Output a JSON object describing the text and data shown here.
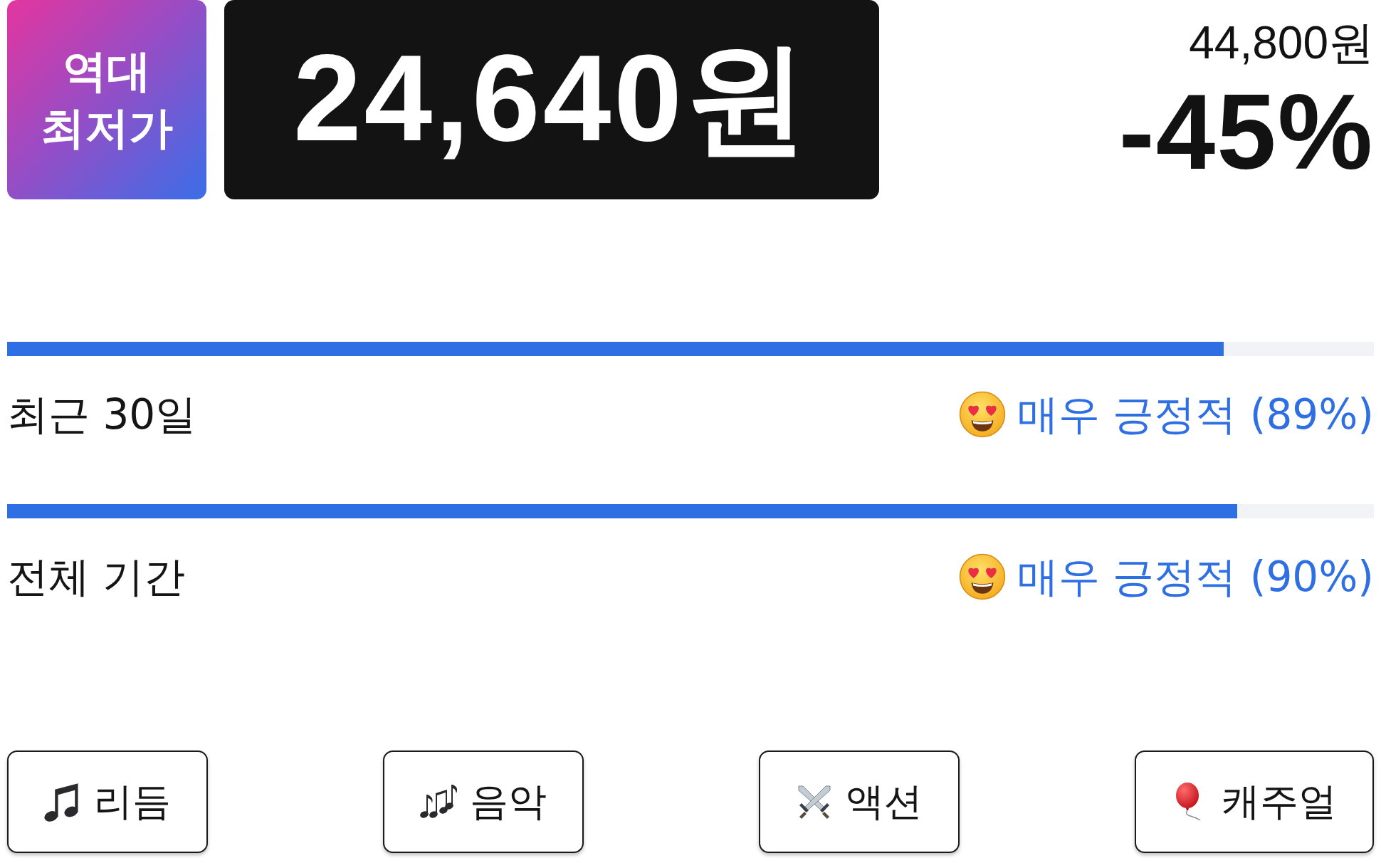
{
  "price": {
    "badge": "역대 최저가",
    "sale_price": "24,640원",
    "original_price": "44,800원",
    "discount": "-45%"
  },
  "reviews": [
    {
      "period": "최근 30일",
      "level": 0.89,
      "summary": "매우 긍정적 (89%)"
    },
    {
      "period": "전체 기간",
      "level": 0.9,
      "summary": "매우 긍정적 (90%)"
    }
  ],
  "tags": [
    {
      "kind": "rhythm",
      "label": "리듬"
    },
    {
      "kind": "music",
      "label": "음악"
    },
    {
      "kind": "action",
      "label": "액션"
    },
    {
      "kind": "casual",
      "label": "캐주얼"
    }
  ]
}
